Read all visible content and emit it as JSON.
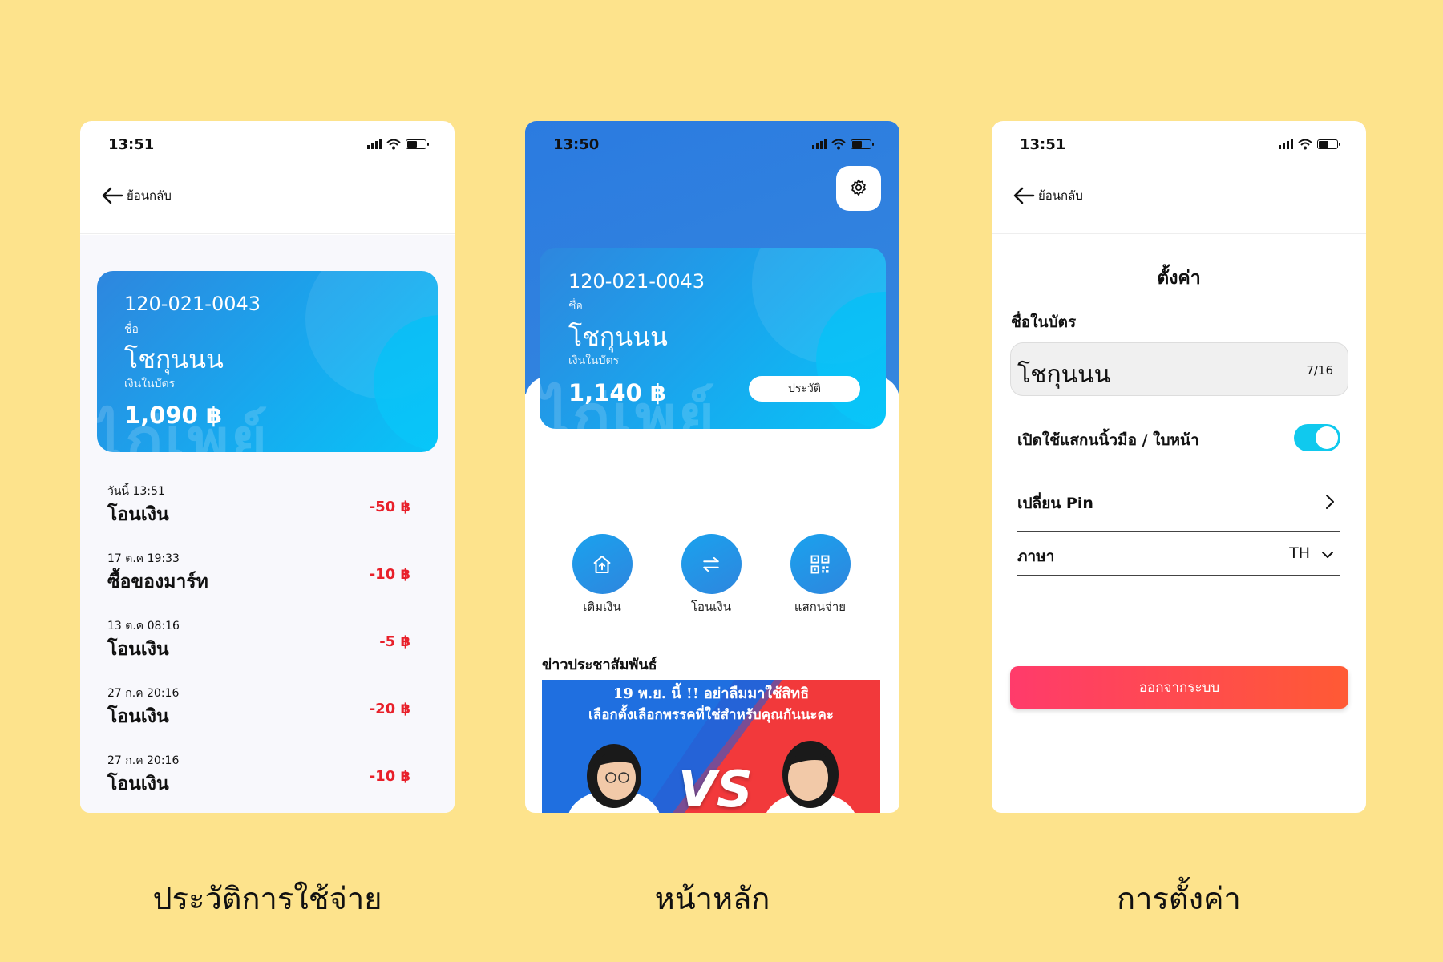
{
  "statusbar": {
    "history_time": "13:51",
    "home_time": "13:50",
    "settings_time": "13:51"
  },
  "nav": {
    "back_label": "ย้อนกลับ"
  },
  "card": {
    "account_number": "120-021-0043",
    "name_label": "ชื่อ",
    "name": "โชกุนนน",
    "balance_label": "เงินในบัตร",
    "watermark": "ไก่เพย์",
    "history_balance": "1,090 ฿",
    "home_balance": "1,140 ฿"
  },
  "history": {
    "transactions": [
      {
        "date": "วันนี้ 13:51",
        "desc": "โอนเงิน",
        "amount": "-50 ฿"
      },
      {
        "date": "17 ต.ค 19:33",
        "desc": "ซื้อของมาร์ท",
        "amount": "-10 ฿"
      },
      {
        "date": "13 ต.ค 08:16",
        "desc": "โอนเงิน",
        "amount": "-5 ฿"
      },
      {
        "date": "27 ก.ค 20:16",
        "desc": "โอนเงิน",
        "amount": "-20 ฿"
      },
      {
        "date": "27 ก.ค 20:16",
        "desc": "โอนเงิน",
        "amount": "-10 ฿"
      }
    ]
  },
  "home": {
    "history_button": "ประวัติ",
    "actions": [
      {
        "label": "เติมเงิน",
        "icon": "topup-icon"
      },
      {
        "label": "โอนเงิน",
        "icon": "transfer-icon"
      },
      {
        "label": "แสกนจ่าย",
        "icon": "qr-icon"
      }
    ],
    "news_title": "ข่าวประชาสัมพันธ์",
    "banner_line1": "19 พ.ย. นี้ !! อย่าลืมมาใช้สิทธิ",
    "banner_line2": "เลือกตั้งเลือกพรรคที่ใช่สำหรับคุณกันนะคะ",
    "banner_vs": "VS"
  },
  "settings": {
    "title": "ตั้งค่า",
    "name_label": "ชื่อในบัตร",
    "name_value": "โชกุนนน",
    "name_count": "7/16",
    "biometric_label": "เปิดใช้แสกนนิ้วมือ / ใบหน้า",
    "biometric_on": true,
    "change_pin_label": "เปลี่ยน Pin",
    "language_label": "ภาษา",
    "language_value": "TH",
    "logout_label": "ออกจากระบบ"
  },
  "captions": {
    "history": "ประวัติการใช้จ่าย",
    "home": "หน้าหลัก",
    "settings": "การตั้งค่า"
  },
  "colors": {
    "background": "#FDE38C",
    "accent_blue": "#2E86DE",
    "cyan": "#08C4F7",
    "negative": "#E8202A",
    "toggle": "#10C9EE",
    "logout_start": "#FF3B6B",
    "logout_end": "#FF5A34",
    "shadow_yellow": "#F9B826"
  }
}
